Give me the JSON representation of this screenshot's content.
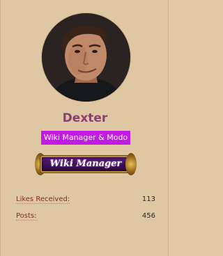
{
  "profile": {
    "username": "Dexter",
    "role_badge": "Wiki Manager & Modo",
    "rank_banner": "Wiki Manager",
    "avatar_icon": "user-avatar-photo"
  },
  "stats": {
    "likes_label": "Likes Received:",
    "likes_value": "113",
    "posts_label": "Posts:",
    "posts_value": "456"
  },
  "colors": {
    "background": "#e0c7a4",
    "username": "#8a3f71",
    "badge": "#c21be6",
    "stat_label": "#7a2e26"
  }
}
